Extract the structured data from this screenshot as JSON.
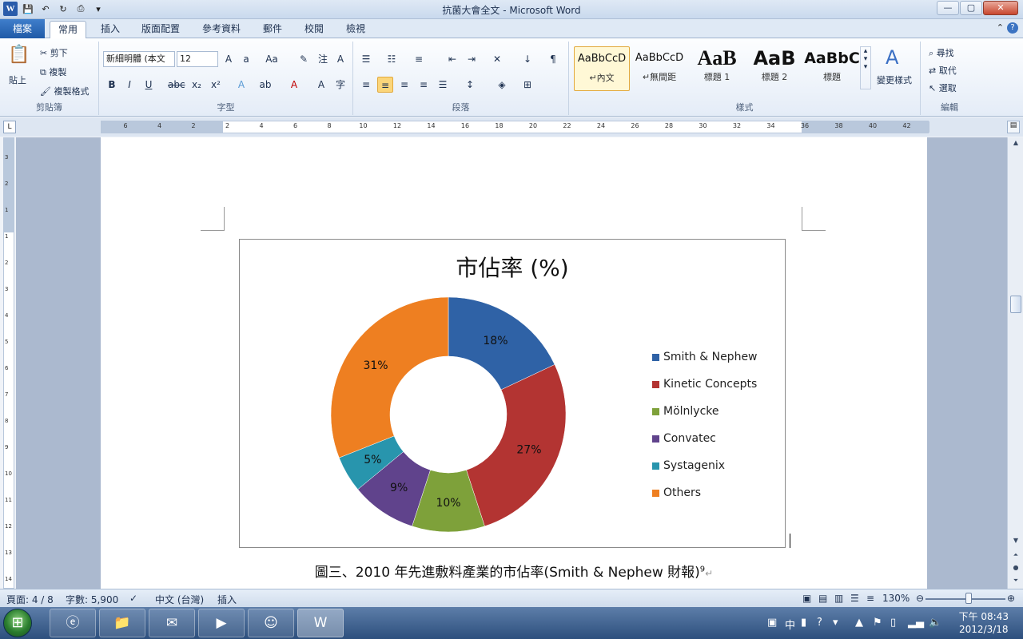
{
  "window": {
    "title": "抗菌大會全文 - Microsoft Word",
    "controls": {
      "minimize": "—",
      "maximize": "▢",
      "close": "✕"
    }
  },
  "ribbon_tabs": [
    "檔案",
    "常用",
    "插入",
    "版面配置",
    "參考資料",
    "郵件",
    "校閱",
    "檢視"
  ],
  "active_tab": "常用",
  "clipboard": {
    "paste": "貼上",
    "cut": "剪下",
    "copy": "複製",
    "format_painter": "複製格式",
    "label": "剪貼簿"
  },
  "font": {
    "name": "新細明體 (本文",
    "size": "12",
    "label": "字型"
  },
  "paragraph": {
    "label": "段落"
  },
  "styles": {
    "items": [
      {
        "sample": "AaBbCcD",
        "name": "↵內文"
      },
      {
        "sample": "AaBbCcD",
        "name": "↵無間距"
      },
      {
        "sample": "AaB",
        "name": "標題 1"
      },
      {
        "sample": "AaB",
        "name": "標題 2"
      },
      {
        "sample": "AaBbC",
        "name": "標題"
      }
    ],
    "change": "變更樣式",
    "label": "樣式"
  },
  "editing": {
    "find": "尋找",
    "replace": "取代",
    "select": "選取",
    "label": "編輯"
  },
  "ruler_ticks": [
    "6",
    "4",
    "2",
    "2",
    "4",
    "6",
    "8",
    "10",
    "12",
    "14",
    "16",
    "18",
    "20",
    "22",
    "24",
    "26",
    "28",
    "30",
    "32",
    "34",
    "36",
    "38",
    "40",
    "42"
  ],
  "vruler_ticks": [
    "3",
    "2",
    "1",
    "1",
    "2",
    "3",
    "4",
    "5",
    "6",
    "7",
    "8",
    "9",
    "10",
    "11",
    "12",
    "13",
    "14"
  ],
  "chart_data": {
    "type": "pie",
    "title": "市佔率 (%)",
    "categories": [
      "Smith & Nephew",
      "Kinetic Concepts",
      "Mölnlycke",
      "Convatec",
      "Systagenix",
      "Others"
    ],
    "values": [
      18,
      27,
      10,
      9,
      5,
      31
    ],
    "labels": [
      "18%",
      "27%",
      "10%",
      "9%",
      "5%",
      "31%"
    ],
    "colors": [
      "#2f62a6",
      "#b33432",
      "#7ea13a",
      "#60438c",
      "#2895ad",
      "#ee7f21"
    ],
    "donut": true,
    "legend": "right"
  },
  "caption": {
    "text": "圖三、2010 年先進敷料產業的市佔率(Smith & Nephew 財報)",
    "sup": "9",
    "mark": "↵"
  },
  "status": {
    "page": "頁面: 4 / 8",
    "words": "字數: 5,900",
    "language": "中文 (台灣)",
    "mode": "插入",
    "zoom": "130%"
  },
  "taskbar": {
    "time": "下午 08:43",
    "date": "2012/3/18",
    "ime": "中"
  }
}
